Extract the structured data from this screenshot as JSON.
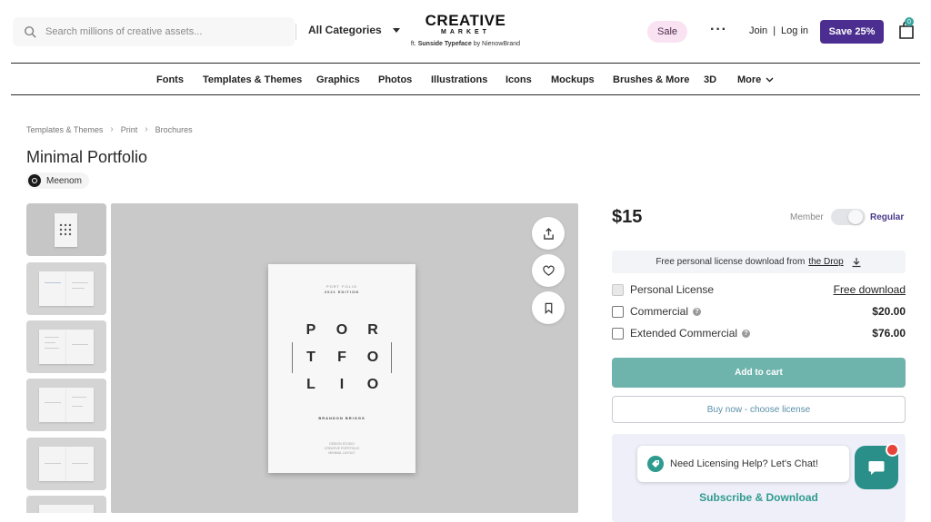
{
  "header": {
    "search_placeholder": "Search millions of creative assets...",
    "categories_label": "All Categories",
    "logo_main": "CREATIVE",
    "logo_sub": "MARKET",
    "logo_credit_prefix": "ft.",
    "logo_credit_font": "Sunside Typeface",
    "logo_credit_by": "by NienowBrand",
    "sale_label": "Sale",
    "more_dots": "···",
    "join_label": "Join",
    "separator": "|",
    "login_label": "Log in",
    "save_label": "Save 25%",
    "cart_count": "0"
  },
  "nav": {
    "items": [
      "Fonts",
      "Templates & Themes",
      "Graphics",
      "Photos",
      "Illustrations",
      "Icons",
      "Mockups",
      "Brushes & More",
      "3D",
      "More"
    ]
  },
  "breadcrumb": [
    "Templates & Themes",
    "Print",
    "Brochures"
  ],
  "product": {
    "title": "Minimal Portfolio",
    "author": "Meenom"
  },
  "brochure": {
    "tiny_top_1": "PORT FOLIO",
    "tiny_top_2": "2021 EDITION",
    "row1": [
      "P",
      "O",
      "R"
    ],
    "row2": [
      "T",
      "F",
      "O"
    ],
    "row3": [
      "L",
      "I",
      "O"
    ],
    "author_line": "BRANDON BRIGGS",
    "foot_1": "DESIGN STUDIO",
    "foot_2": "CREATIVE PORTFOLIO",
    "foot_3": "MINIMAL LAYOUT"
  },
  "purchase": {
    "price": "$15",
    "member_label": "Member",
    "regular_label": "Regular",
    "free_banner_prefix": "Free personal license download from",
    "free_banner_link": "the Drop",
    "licenses": [
      {
        "name": "Personal License",
        "action": "Free download",
        "disabled": true
      },
      {
        "name": "Commercial",
        "price": "$20.00"
      },
      {
        "name": "Extended Commercial",
        "price": "$76.00"
      }
    ],
    "add_to_cart": "Add to cart",
    "buy_now": "Buy now - choose license",
    "chat_text": "Need Licensing Help? Let's Chat!",
    "subscribe": "Subscribe & Download"
  },
  "colors": {
    "brand_purple": "#4b2e8f",
    "teal": "#6fb3ad",
    "sale_pink": "#f9e3f3"
  }
}
